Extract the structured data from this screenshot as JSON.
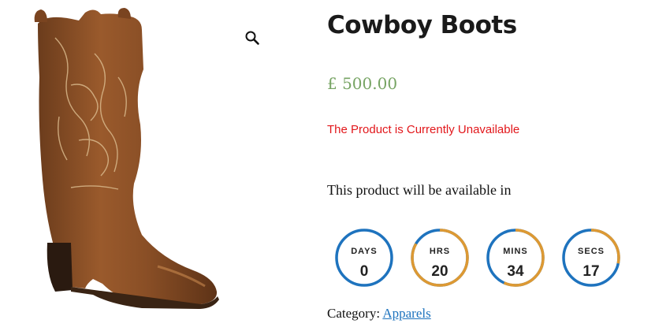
{
  "product": {
    "title": "Cowboy Boots",
    "price": "£ 500.00",
    "status": "The Product is Currently Unavailable",
    "availability_text": "This product will be available in",
    "category_label": "Category:",
    "category_link": "Apparels"
  },
  "gallery": {
    "zoom_icon": "magnifier-icon",
    "image_subject": "boot-image"
  },
  "countdown": {
    "ring_color": "#1e73be",
    "progress_color": "#dd9933",
    "items": [
      {
        "label": "DAYS",
        "value": "0",
        "fraction": 0.0
      },
      {
        "label": "HRS",
        "value": "20",
        "fraction": 0.833
      },
      {
        "label": "MINS",
        "value": "34",
        "fraction": 0.567
      },
      {
        "label": "SECS",
        "value": "17",
        "fraction": 0.283
      }
    ]
  },
  "colors": {
    "price": "#77a464",
    "status": "#e2171b",
    "link": "#1e73be"
  }
}
